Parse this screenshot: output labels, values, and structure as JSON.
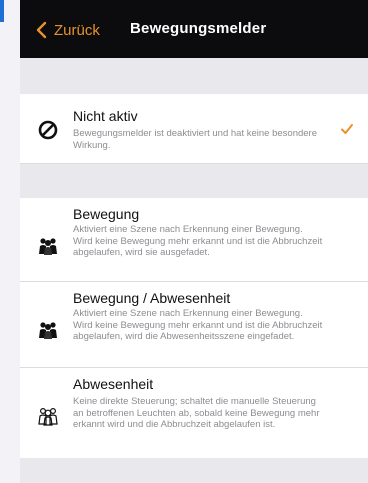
{
  "nav": {
    "back_label": "Zurück",
    "title": "Bewegungsmelder"
  },
  "options": [
    {
      "title": "Nicht aktiv",
      "description": "Bewegungsmelder ist deaktiviert und hat keine besondere Wirkung.",
      "icon": "prohibited-icon",
      "selected": true
    },
    {
      "title": "Bewegung",
      "description": "Aktiviert eine Szene nach Erkennung einer Bewegung. Wird keine Bewegung mehr erkannt und ist die Abbruchzeit abgelaufen, wird sie ausgefadet.",
      "icon": "people-icon",
      "selected": false
    },
    {
      "title": "Bewegung / Abwesenheit",
      "description": "Aktiviert eine Szene nach Erkennung einer Bewegung. Wird keine Bewegung mehr erkannt und ist die Abbruchzeit abgelaufen, wird die Abwesenheitsszene eingefadet.",
      "icon": "people-icon",
      "selected": false
    },
    {
      "title": "Abwesenheit",
      "description": "Keine direkte Steuerung; schaltet die manuelle Steuerung an betroffenen Leuchten ab, sobald keine Bewegung mehr erkannt wird und die Abbruchzeit abgelaufen ist.",
      "icon": "people-outline-icon",
      "selected": false
    }
  ],
  "colors": {
    "accent": "#e8912d",
    "navbar_bg": "#0c0c0e",
    "page_bg": "#f2f2f7"
  }
}
